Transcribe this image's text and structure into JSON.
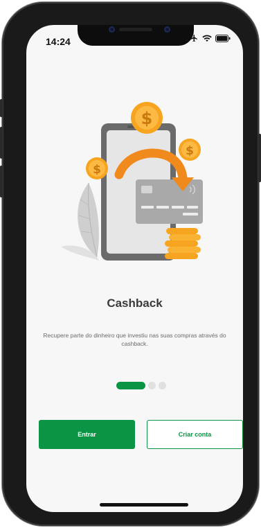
{
  "status_bar": {
    "time": "14:24",
    "icons": [
      "airplane-icon",
      "wifi-icon",
      "battery-icon"
    ]
  },
  "onboarding": {
    "illustration": "cashback-illustration",
    "title": "Cashback",
    "description": "Recupere parte do dinheiro que investiu nas suas compras através do cashback.",
    "pager": {
      "current_page": 1,
      "total_pages": 3
    }
  },
  "actions": {
    "login_label": "Entrar",
    "signup_label": "Criar conta"
  },
  "colors": {
    "primary": "#0b9444",
    "coin": "#f7a520",
    "arrow": "#f08a1c",
    "card": "#a9a9a9",
    "phone": "#6b6b6b"
  }
}
